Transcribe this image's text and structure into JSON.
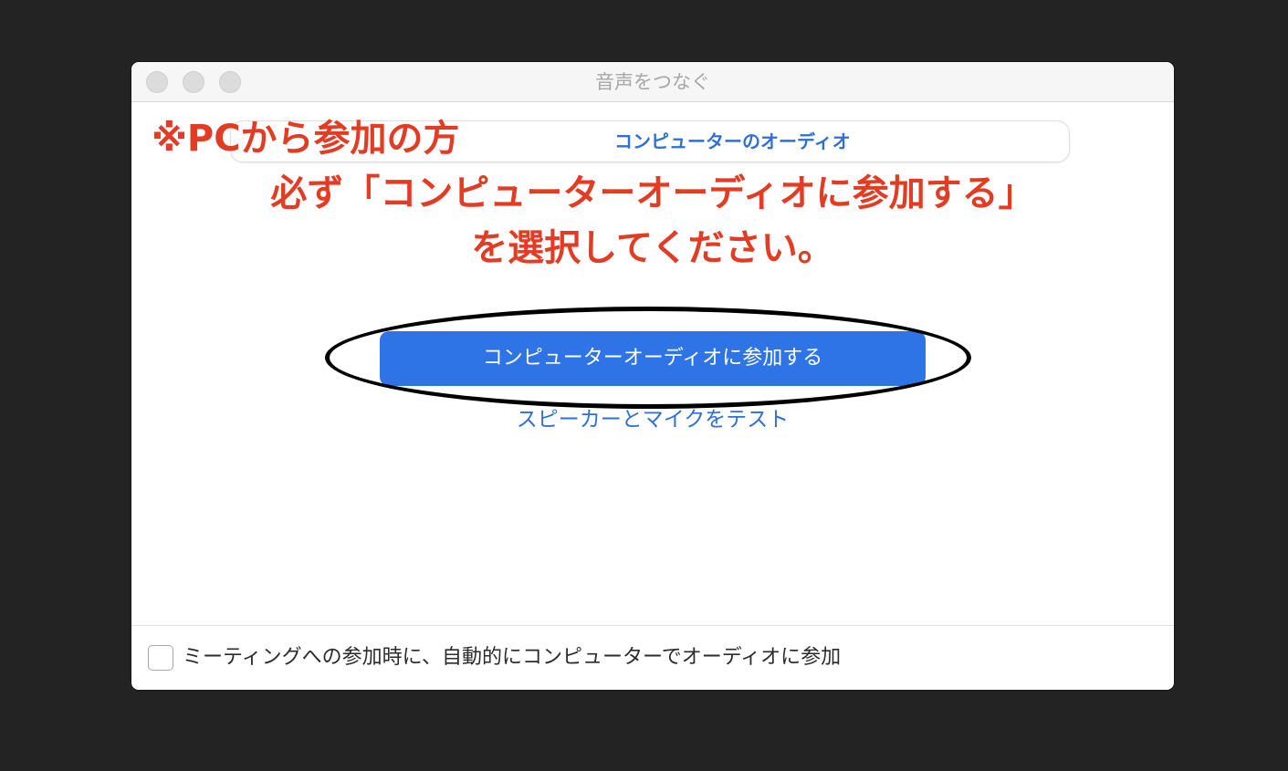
{
  "window": {
    "title": "音声をつなぐ"
  },
  "tabs": {
    "computer_audio_label": "コンピューターのオーディオ"
  },
  "annotation": {
    "pc_note": "※PCから参加の方",
    "instruction_line1": "必ず「コンピューターオーディオに参加する」",
    "instruction_line2": "を選択してください。",
    "color": "#e23d24"
  },
  "main": {
    "join_button_label": "コンピューターオーディオに参加する",
    "test_link_label": "スピーカーとマイクをテスト"
  },
  "footer": {
    "auto_join_label": "ミーティングへの参加時に、自動的にコンピューターでオーディオに参加",
    "auto_join_checked": false
  },
  "colors": {
    "accent": "#2f74e6",
    "link": "#2f6fd6",
    "background": "#232323"
  }
}
